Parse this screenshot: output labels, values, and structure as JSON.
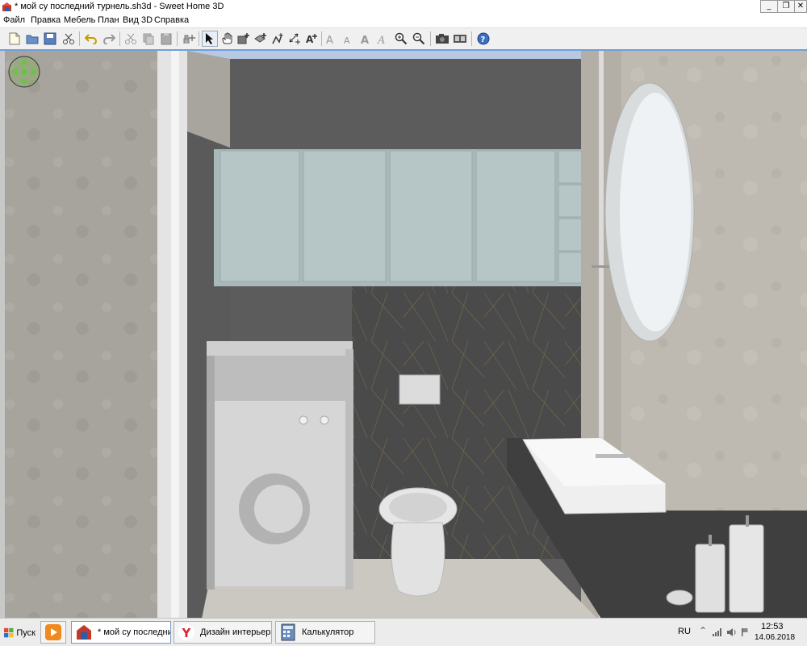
{
  "window": {
    "title": "* мой су последний турнель.sh3d - Sweet Home 3D",
    "controls": {
      "minimize": "_",
      "restore": "❐",
      "close": "✕"
    }
  },
  "menu": [
    "Файл",
    "Правка",
    "Мебель",
    "План",
    "Вид 3D",
    "Справка"
  ],
  "toolbar": [
    {
      "icon": "new-file-icon"
    },
    {
      "icon": "open-icon"
    },
    {
      "icon": "save-icon"
    },
    {
      "icon": "cut-preferences-icon"
    },
    {
      "icon": "undo-icon"
    },
    {
      "icon": "redo-icon"
    },
    {
      "icon": "cut-icon"
    },
    {
      "icon": "copy-icon"
    },
    {
      "icon": "paste-icon"
    },
    {
      "icon": "add-furniture-icon"
    },
    {
      "icon": "select-cursor-icon"
    },
    {
      "icon": "pan-hand-icon"
    },
    {
      "icon": "create-walls-icon"
    },
    {
      "icon": "create-rooms-icon"
    },
    {
      "icon": "create-polylines-icon"
    },
    {
      "icon": "create-dimensions-icon"
    },
    {
      "icon": "add-text-icon"
    },
    {
      "icon": "increase-text-icon"
    },
    {
      "icon": "decrease-text-icon"
    },
    {
      "icon": "bold-text-icon"
    },
    {
      "icon": "italic-text-icon"
    },
    {
      "icon": "zoom-in-icon"
    },
    {
      "icon": "zoom-out-icon"
    },
    {
      "icon": "create-photo-icon"
    },
    {
      "icon": "create-video-icon"
    },
    {
      "icon": "help-icon"
    }
  ],
  "taskbar": {
    "start_label": "Пуск",
    "tasks": [
      {
        "label": "* мой су последни...",
        "active": true
      },
      {
        "label": "Дизайн интерьера ...",
        "active": false
      },
      {
        "label": "Калькулятор",
        "active": false
      }
    ],
    "language": "RU",
    "time": "12:53",
    "date": "14.06.2018"
  },
  "colors": {
    "accent": "#6e9fd8",
    "title_bar": "#ffffff",
    "toolbar": "#f0f0f0"
  }
}
